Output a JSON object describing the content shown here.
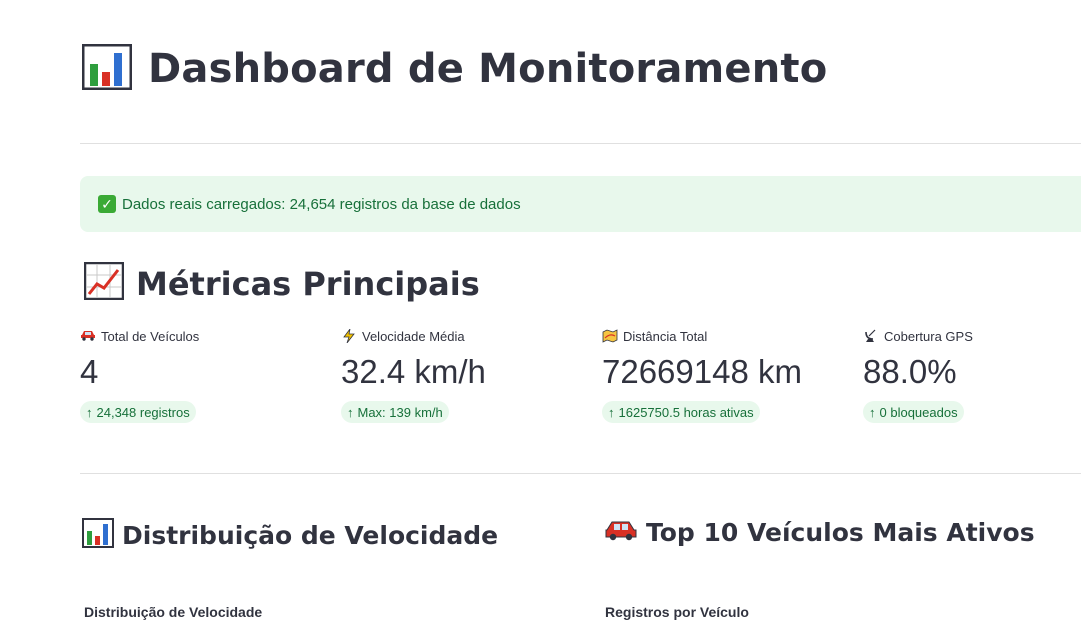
{
  "header": {
    "title": "Dashboard de Monitoramento",
    "icon": "bar-chart-icon"
  },
  "alert": {
    "icon": "check-mark-icon",
    "text": "Dados reais carregados: 24,654 registros da base de dados"
  },
  "metrics_section": {
    "title": "Métricas Principais",
    "icon": "line-chart-icon"
  },
  "metrics": [
    {
      "icon": "car-icon",
      "label": "Total de Veículos",
      "value": "4",
      "delta": "24,348 registros"
    },
    {
      "icon": "lightning-icon",
      "label": "Velocidade Média",
      "value": "32.4 km/h",
      "delta": "Max: 139 km/h"
    },
    {
      "icon": "map-icon",
      "label": "Distância Total",
      "value": "72669148 km",
      "delta": "1625750.5 horas ativas"
    },
    {
      "icon": "satellite-icon",
      "label": "Cobertura GPS",
      "value": "88.0%",
      "delta": "0 bloqueados"
    }
  ],
  "sections": {
    "speed": {
      "icon": "bar-chart-icon",
      "title": "Distribuição de Velocidade",
      "subtitle": "Distribuição de Velocidade"
    },
    "vehicles": {
      "icon": "car-icon",
      "title": "Top 10 Veículos Mais Ativos",
      "subtitle": "Registros por Veículo"
    }
  },
  "colors": {
    "success_bg": "#e8f8ec",
    "success_text": "#17703a",
    "text": "#31333f"
  }
}
